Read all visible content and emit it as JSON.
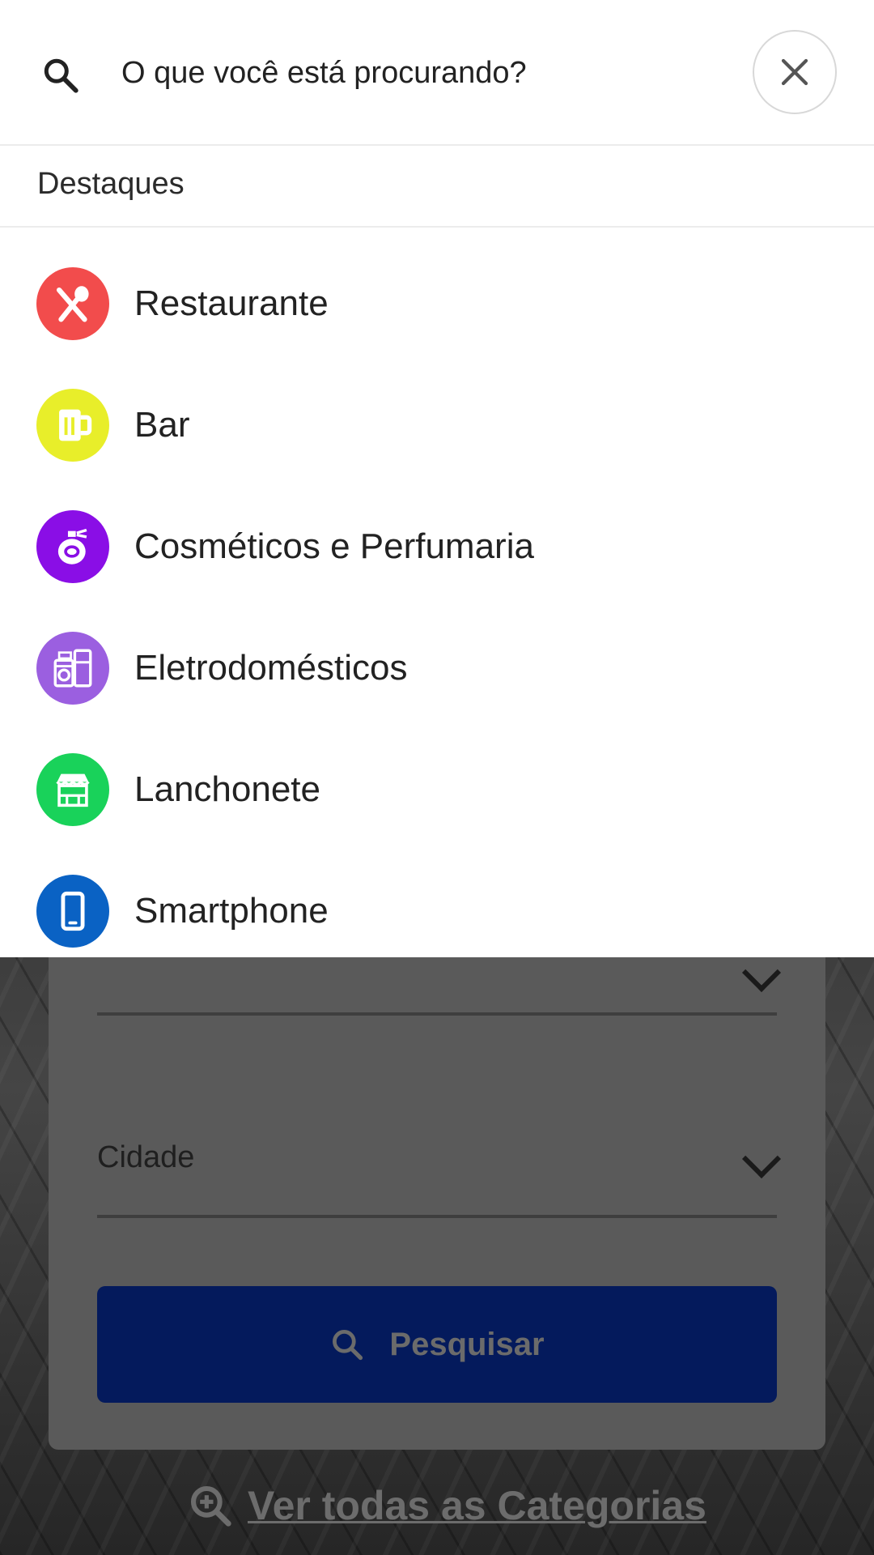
{
  "search": {
    "placeholder": "O que você está procurando?",
    "value": ""
  },
  "highlights": {
    "title": "Destaques",
    "items": [
      {
        "label": "Restaurante",
        "icon": "fork-spoon-icon",
        "color": "#f24c4c"
      },
      {
        "label": "Bar",
        "icon": "beer-mug-icon",
        "color": "#e8ee2a"
      },
      {
        "label": "Cosméticos e Perfumaria",
        "icon": "perfume-bottle-icon",
        "color": "#8a0ee6"
      },
      {
        "label": "Eletrodomésticos",
        "icon": "appliances-icon",
        "color": "#9b5fe0"
      },
      {
        "label": "Lanchonete",
        "icon": "snack-bar-storefront-icon",
        "color": "#19d25a"
      },
      {
        "label": "Smartphone",
        "icon": "smartphone-icon",
        "color": "#0a62c4"
      }
    ]
  },
  "background_form": {
    "city_label": "Cidade",
    "search_button": "Pesquisar",
    "all_categories_link": "Ver todas as Categorias"
  }
}
